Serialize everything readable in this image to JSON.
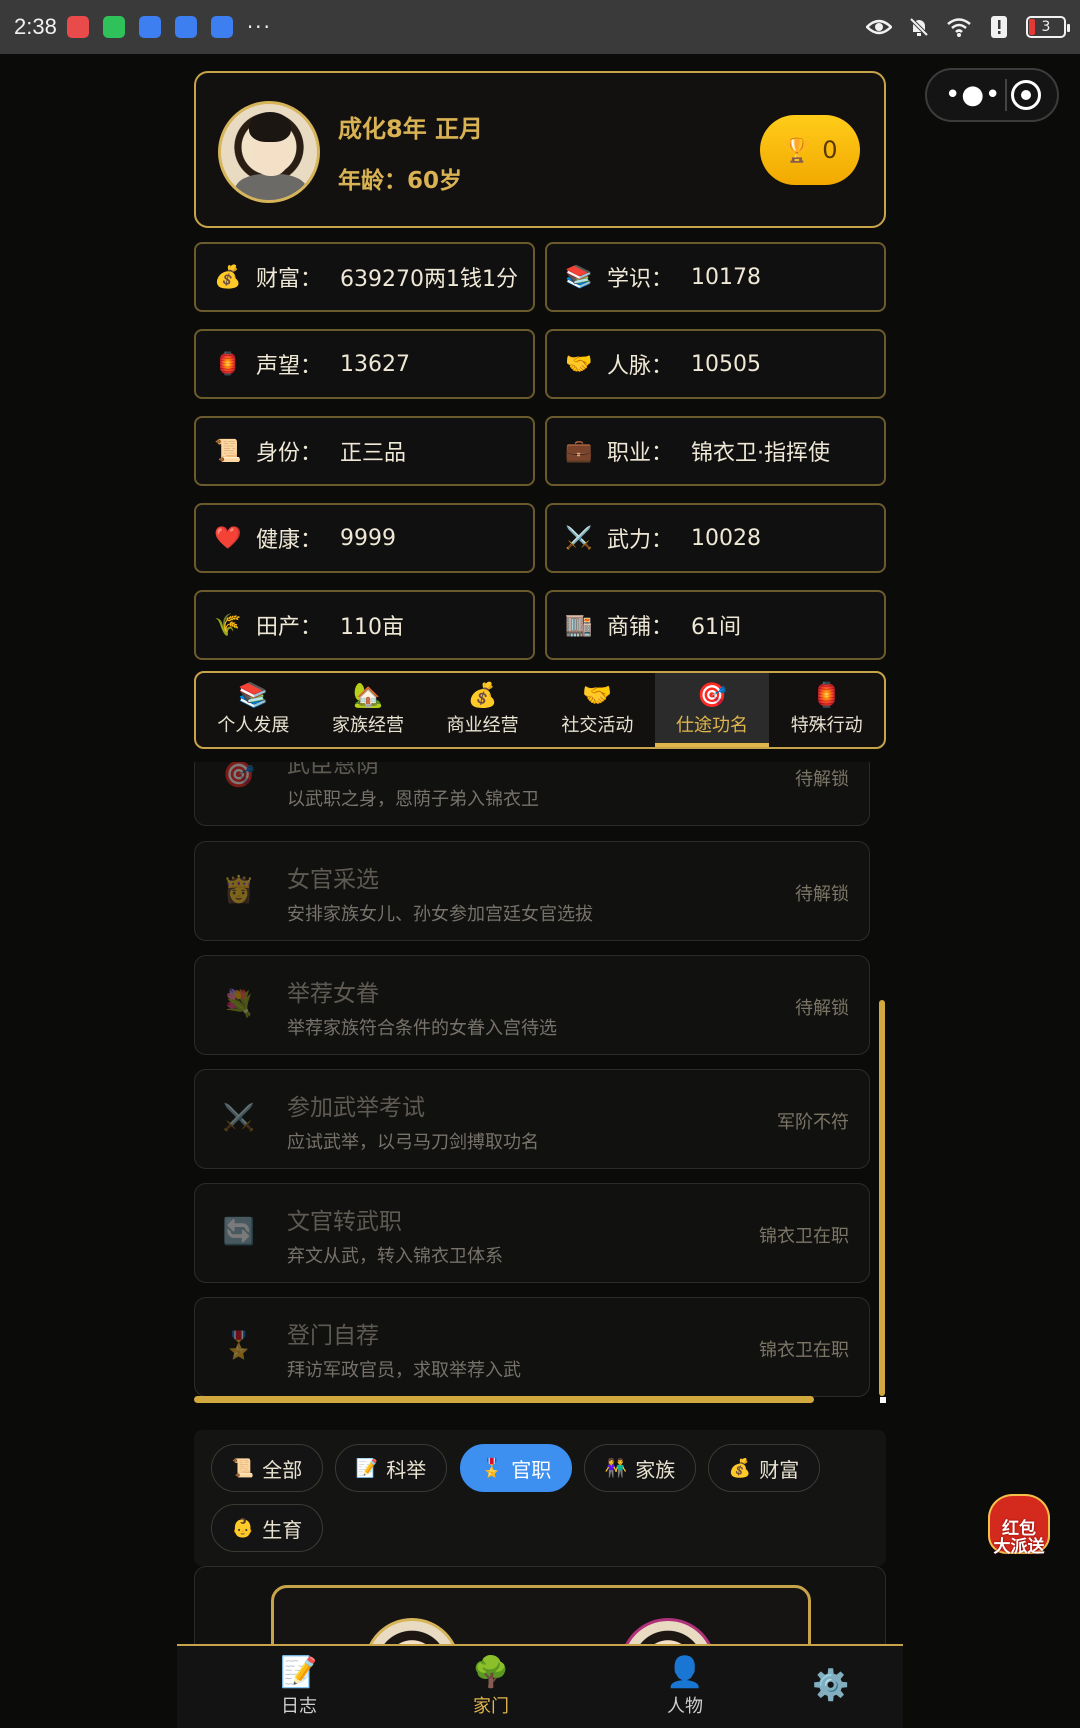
{
  "statusbar": {
    "time": "2:38",
    "dots": "···",
    "battery": "3",
    "app_colors": [
      "#e94b4b",
      "#2fc25b",
      "#3d7ef0",
      "#3d7ef0",
      "#3d7ef0"
    ]
  },
  "header": {
    "date": "成化8年 正月",
    "age": "年龄：60岁",
    "trophy_icon": "🏆",
    "trophy_count": "0"
  },
  "stats": [
    {
      "icon": "💰",
      "label": "财富：",
      "value": "639270两1钱1分"
    },
    {
      "icon": "📚",
      "label": "学识：",
      "value": "10178"
    },
    {
      "icon": "🏮",
      "label": "声望：",
      "value": "13627"
    },
    {
      "icon": "🤝",
      "label": "人脉：",
      "value": "10505"
    },
    {
      "icon": "📜",
      "label": "身份：",
      "value": "正三品"
    },
    {
      "icon": "💼",
      "label": "职业：",
      "value": "锦衣卫·指挥使"
    },
    {
      "icon": "❤️",
      "label": "健康：",
      "value": "9999"
    },
    {
      "icon": "⚔️",
      "label": "武力：",
      "value": "10028"
    },
    {
      "icon": "🌾",
      "label": "田产：",
      "value": "110亩"
    },
    {
      "icon": "🏬",
      "label": "商铺：",
      "value": "61间"
    }
  ],
  "tabs": [
    {
      "icon": "📚",
      "label": "个人发展"
    },
    {
      "icon": "🏡",
      "label": "家族经营"
    },
    {
      "icon": "💰",
      "label": "商业经营"
    },
    {
      "icon": "🤝",
      "label": "社交活动"
    },
    {
      "icon": "🎯",
      "label": "仕途功名",
      "active": true
    },
    {
      "icon": "🏮",
      "label": "特殊行动"
    }
  ],
  "actions": [
    {
      "icon": "🎯",
      "title": "武臣恩荫",
      "desc": "以武职之身，恩荫子弟入锦衣卫",
      "status": "待解锁"
    },
    {
      "icon": "👸",
      "title": "女官采选",
      "desc": "安排家族女儿、孙女参加宫廷女官选拔",
      "status": "待解锁"
    },
    {
      "icon": "💐",
      "title": "举荐女眷",
      "desc": "举荐家族符合条件的女眷入宫待选",
      "status": "待解锁"
    },
    {
      "icon": "⚔️",
      "title": "参加武举考试",
      "desc": "应试武举，以弓马刀剑搏取功名",
      "status": "军阶不符"
    },
    {
      "icon": "🔄",
      "title": "文官转武职",
      "desc": "弃文从武，转入锦衣卫体系",
      "status": "锦衣卫在职"
    },
    {
      "icon": "🎖️",
      "title": "登门自荐",
      "desc": "拜访军政官员，求取举荐入武",
      "status": "锦衣卫在职"
    }
  ],
  "filters": [
    {
      "icon": "📜",
      "label": "全部"
    },
    {
      "icon": "📝",
      "label": "科举"
    },
    {
      "icon": "🎖️",
      "label": "官职",
      "active": true
    },
    {
      "icon": "👫",
      "label": "家族"
    },
    {
      "icon": "💰",
      "label": "财富"
    },
    {
      "icon": "👶",
      "label": "生育"
    }
  ],
  "bottom_nav": [
    {
      "icon": "📝",
      "label": "日志"
    },
    {
      "icon": "🌳",
      "label": "家门",
      "active": true
    },
    {
      "icon": "👤",
      "label": "人物"
    },
    {
      "icon": "⚙️",
      "label": ""
    }
  ],
  "promo": {
    "text_line1": "红包",
    "text_line2": "大派送"
  },
  "colors": {
    "accent_gold": "#c7a34a",
    "active_blue": "#3d8ff0",
    "trophy_yellow": "#ffcc1a"
  }
}
